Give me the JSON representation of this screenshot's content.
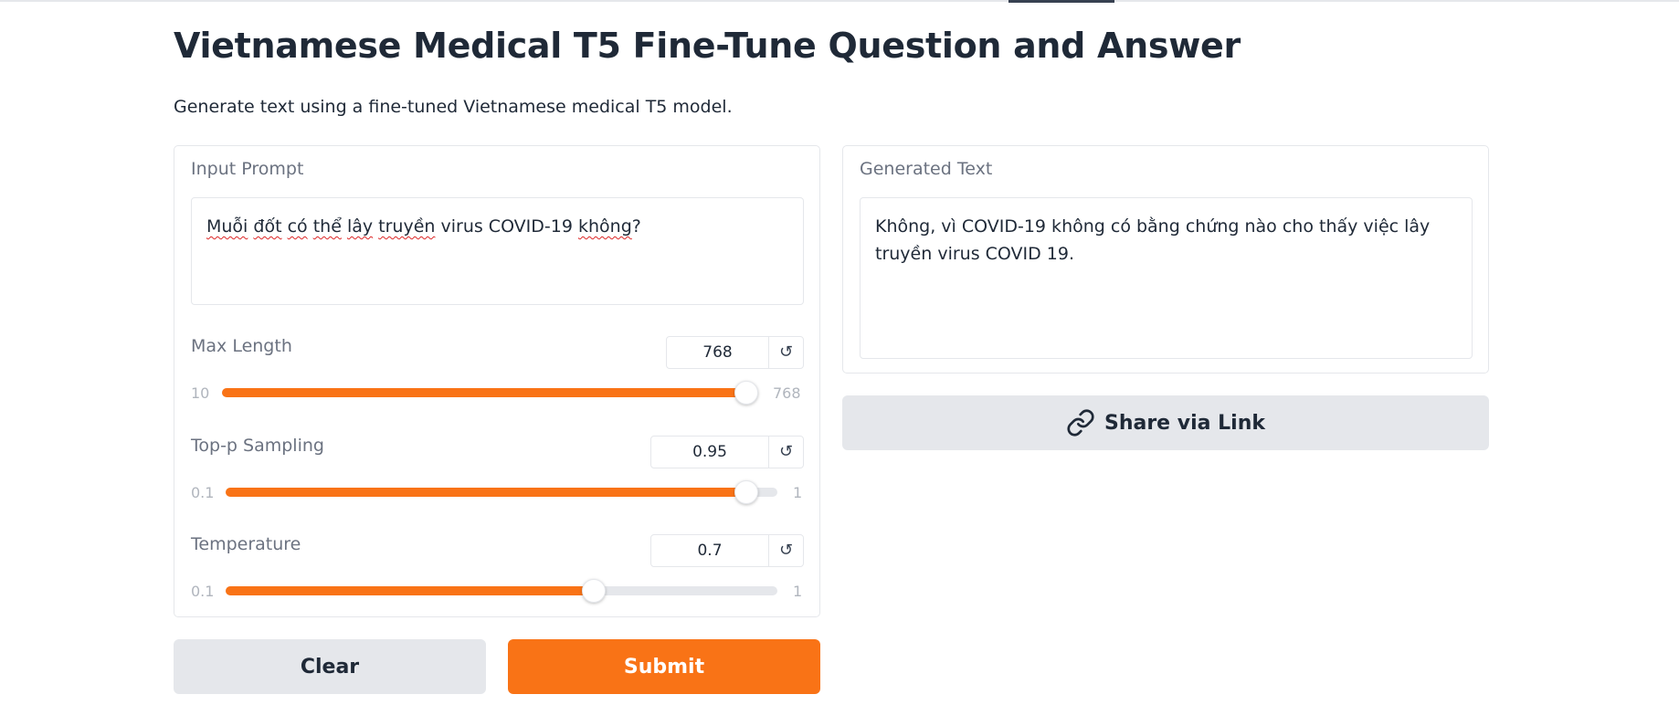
{
  "header": {
    "title": "Vietnamese Medical T5 Fine-Tune Question and Answer",
    "description": "Generate text using a fine-tuned Vietnamese medical T5 model."
  },
  "input": {
    "label": "Input Prompt",
    "value_words": [
      "Muỗi",
      "đốt",
      "có",
      "thể",
      "lây",
      "truyền",
      "virus COVID-19",
      "không",
      "?"
    ]
  },
  "sliders": {
    "max_length": {
      "label": "Max Length",
      "value": "768",
      "min": "10",
      "max": "768",
      "fraction": 1.0,
      "reset_icon": "reset-icon"
    },
    "top_p": {
      "label": "Top-p Sampling",
      "value": "0.95",
      "min": "0.1",
      "max": "1",
      "fraction": 0.944,
      "reset_icon": "reset-icon"
    },
    "temperature": {
      "label": "Temperature",
      "value": "0.7",
      "min": "0.1",
      "max": "1",
      "fraction": 0.667,
      "reset_icon": "reset-icon"
    }
  },
  "output": {
    "label": "Generated Text",
    "value": "Không, vì COVID-19 không có bằng chứng nào cho thấy việc lây truyền virus COVID 19."
  },
  "buttons": {
    "clear": "Clear",
    "submit": "Submit",
    "share": "Share via Link",
    "share_icon": "link-icon"
  },
  "colors": {
    "accent": "#f97316",
    "button_secondary": "#e5e7eb",
    "border": "#e5e7eb"
  }
}
